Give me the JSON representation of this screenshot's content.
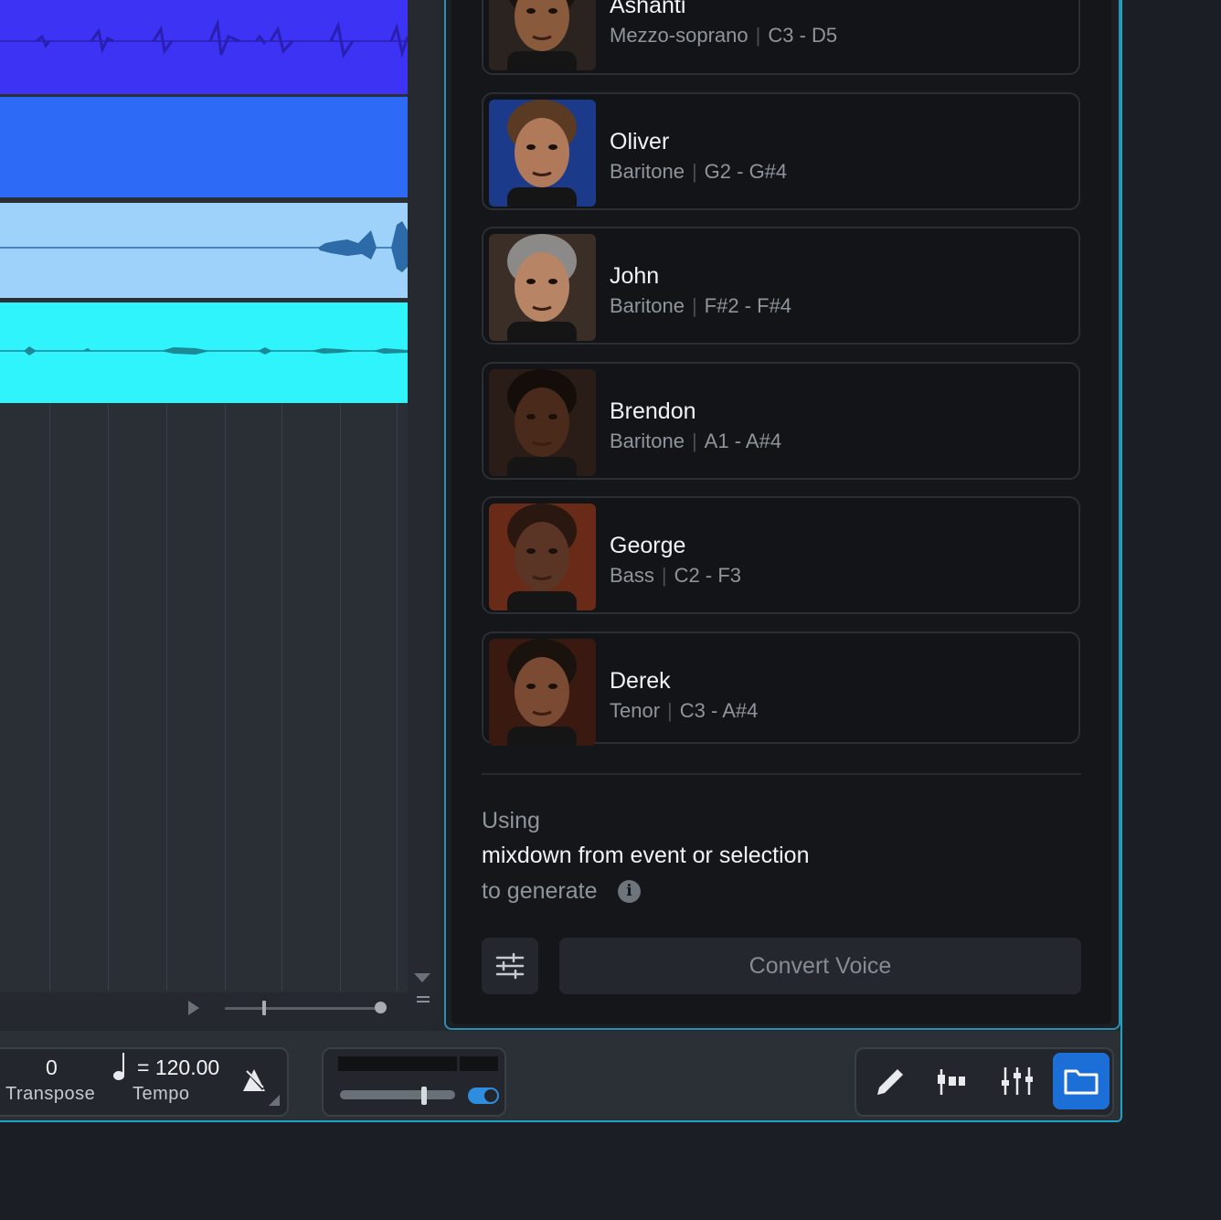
{
  "voices": [
    {
      "name": "Ashanti",
      "type": "Mezzo-soprano",
      "range": "C3 - D5",
      "skin": "#8a5a3c",
      "hair": "#1c130e",
      "bg": "#2a2320"
    },
    {
      "name": "Oliver",
      "type": "Baritone",
      "range": "G2 - G#4",
      "skin": "#b07a5a",
      "hair": "#5a3a22",
      "bg": "#1b3a8a"
    },
    {
      "name": "John",
      "type": "Baritone",
      "range": "F#2 - F#4",
      "skin": "#b88466",
      "hair": "#8b8a88",
      "bg": "#3a2e26"
    },
    {
      "name": "Brendon",
      "type": "Baritone",
      "range": "A1 - A#4",
      "skin": "#4a2a1a",
      "hair": "#140d09",
      "bg": "#2a1c16"
    },
    {
      "name": "George",
      "type": "Bass",
      "range": "C2 - F3",
      "skin": "#5a3424",
      "hair": "#2a1810",
      "bg": "#6a2a18"
    },
    {
      "name": "Derek",
      "type": "Tenor",
      "range": "C3 - A#4",
      "skin": "#7a4a32",
      "hair": "#1a120d",
      "bg": "#3a1a10"
    }
  ],
  "generate": {
    "using": "Using",
    "source": "mixdown from event or selection",
    "to_generate": "to generate",
    "info_icon": "i"
  },
  "convert_button": "Convert Voice",
  "transport": {
    "transpose_value": "0",
    "transpose_label": "Transpose",
    "tempo_value": "= 120.00",
    "tempo_label": "Tempo"
  },
  "tools": [
    "pencil-icon",
    "clip-gain-icon",
    "mixer-icon",
    "folder-icon"
  ],
  "colors": {
    "accent": "#1d6fd8",
    "panel_border": "#2b8fae",
    "track1": "#3c33f5",
    "track2": "#2d6bf7",
    "track3": "#9fd2fa",
    "track4": "#2ff4fc"
  }
}
